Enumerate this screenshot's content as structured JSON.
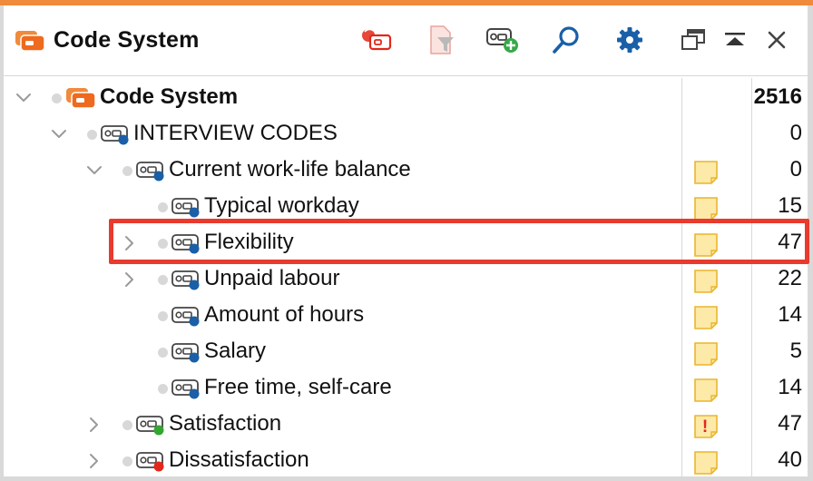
{
  "header": {
    "title": "Code System",
    "toolbar": [
      {
        "name": "reset-activation-icon"
      },
      {
        "name": "filter-document-icon"
      },
      {
        "name": "new-code-icon"
      },
      {
        "name": "search-icon"
      },
      {
        "name": "settings-icon"
      },
      {
        "name": "undock-window-icon"
      },
      {
        "name": "collapse-panel-icon"
      },
      {
        "name": "close-icon"
      }
    ]
  },
  "colors": {
    "accent": "#f08a3c",
    "code_blue": "#1a5fa8",
    "code_green": "#34a533",
    "code_red": "#e3271b",
    "memo_yellow": "#fde9a8",
    "highlight": "#e83a2d"
  },
  "tree": [
    {
      "label": "Code System",
      "count": "2516",
      "level": 0,
      "expander": "expanded",
      "type": "root",
      "memo": ""
    },
    {
      "label": "INTERVIEW CODES",
      "count": "0",
      "level": 1,
      "expander": "expanded",
      "color": "blue",
      "memo": ""
    },
    {
      "label": "Current work-life balance",
      "count": "0",
      "level": 2,
      "expander": "expanded",
      "color": "blue",
      "memo": "plain"
    },
    {
      "label": "Typical workday",
      "count": "15",
      "level": 3,
      "expander": "none",
      "color": "blue",
      "memo": "plain"
    },
    {
      "label": "Flexibility",
      "count": "47",
      "level": 3,
      "expander": "collapsed",
      "color": "blue",
      "memo": "plain",
      "highlighted": true
    },
    {
      "label": "Unpaid labour",
      "count": "22",
      "level": 3,
      "expander": "collapsed",
      "color": "blue",
      "memo": "plain"
    },
    {
      "label": "Amount of hours",
      "count": "14",
      "level": 3,
      "expander": "none",
      "color": "blue",
      "memo": "plain"
    },
    {
      "label": "Salary",
      "count": "5",
      "level": 3,
      "expander": "none",
      "color": "blue",
      "memo": "plain"
    },
    {
      "label": "Free time, self-care",
      "count": "14",
      "level": 3,
      "expander": "none",
      "color": "blue",
      "memo": "plain"
    },
    {
      "label": "Satisfaction",
      "count": "47",
      "level": 2,
      "expander": "collapsed",
      "color": "green",
      "memo": "important",
      "memo_mark": "!"
    },
    {
      "label": "Dissatisfaction",
      "count": "40",
      "level": 2,
      "expander": "collapsed",
      "color": "red",
      "memo": "plain"
    }
  ]
}
